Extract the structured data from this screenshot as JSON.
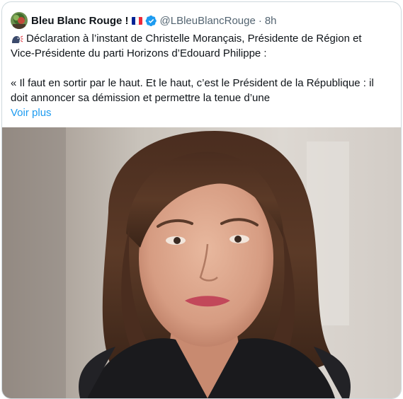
{
  "post": {
    "display_name": "Bleu Blanc Rouge !",
    "handle": "@LBleuBlancRouge",
    "separator": "·",
    "time": "8h",
    "text": {
      "line1": "Déclaration à l’instant de Christelle Morançais, Présidente de Région et",
      "line2": "Vice-Présidente du parti Horizons d’Edouard Philippe :",
      "line3": "« Il faut en sortir par le haut. Et le haut, c’est le Président de la République : il",
      "line4": "doit annoncer sa démission et permettre la tenue d’une"
    },
    "show_more_label": "Voir plus"
  },
  "icons": {
    "avatar": "avatar-image",
    "flag": "france-flag-icon",
    "verified": "verified-badge-icon",
    "speaking": "speaking-head-icon"
  },
  "colors": {
    "link": "#1d9bf0",
    "verified": "#1d9bf0",
    "text": "#0f1419",
    "secondary_text": "#536471",
    "flag_blue": "#002395",
    "flag_white": "#ffffff",
    "flag_red": "#ed2939"
  }
}
